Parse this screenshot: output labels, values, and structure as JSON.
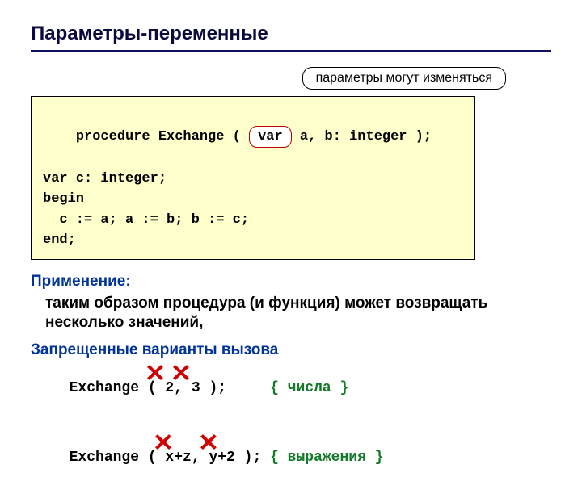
{
  "title": "Параметры-переменные",
  "callout": "параметры могут изменяться",
  "code": {
    "l1a": "procedure Exchange ( ",
    "var_pill": "var",
    "l1b": " a, b: integer );",
    "l2": "var c: integer;",
    "l3": "begin",
    "l4": "  c := a; a := b; b := c;",
    "l5": "end;"
  },
  "application_h": "Применение:",
  "application_text": "таким образом процедура (и функция) может возвращать несколько значений,",
  "forbidden_h": "Запрещенные варианты вызова",
  "forbidden1": {
    "code": "Exchange ( 2, 3 );     ",
    "comment": "{ числа }"
  },
  "forbidden2": {
    "code": "Exchange ( x+z, y+2 ); ",
    "comment": "{ выражения }"
  },
  "cross_glyph": "✕"
}
